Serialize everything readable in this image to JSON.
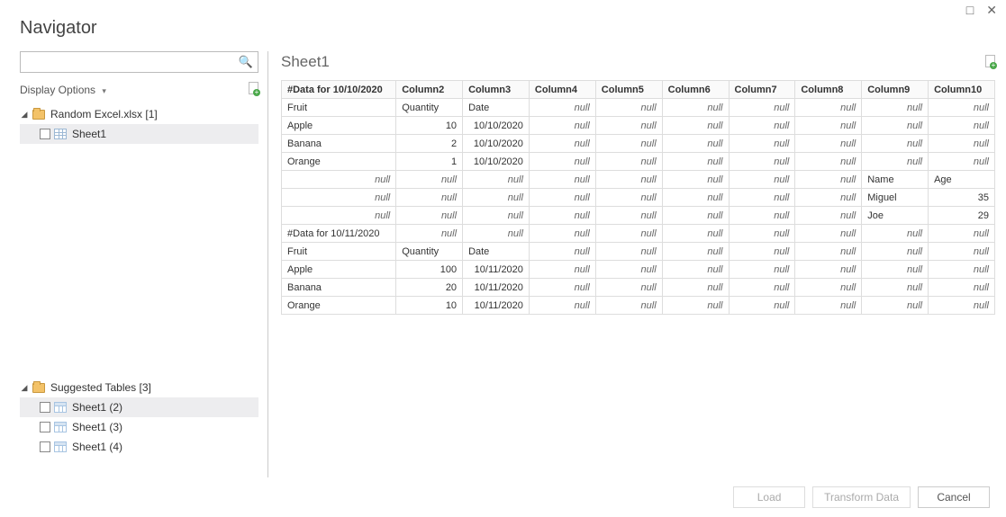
{
  "window": {
    "title": "Navigator",
    "maximize_glyph": "□",
    "close_glyph": "✕"
  },
  "left": {
    "search_placeholder": "",
    "display_options_label": "Display Options",
    "tree": {
      "file_label": "Random Excel.xlsx [1]",
      "file_children": [
        {
          "label": "Sheet1",
          "selected": true
        }
      ],
      "suggested_label": "Suggested Tables [3]",
      "suggested_children": [
        {
          "label": "Sheet1 (2)",
          "selected": true
        },
        {
          "label": "Sheet1 (3)",
          "selected": false
        },
        {
          "label": "Sheet1 (4)",
          "selected": false
        }
      ]
    }
  },
  "preview": {
    "title": "Sheet1",
    "columns": [
      "#Data for 10/10/2020",
      "Column2",
      "Column3",
      "Column4",
      "Column5",
      "Column6",
      "Column7",
      "Column8",
      "Column9",
      "Column10"
    ],
    "right_align_from": 1,
    "rows": [
      [
        "Fruit",
        "Quantity",
        "Date",
        null,
        null,
        null,
        null,
        null,
        null,
        null
      ],
      [
        "Apple",
        "10",
        "10/10/2020",
        null,
        null,
        null,
        null,
        null,
        null,
        null
      ],
      [
        "Banana",
        "2",
        "10/10/2020",
        null,
        null,
        null,
        null,
        null,
        null,
        null
      ],
      [
        "Orange",
        "1",
        "10/10/2020",
        null,
        null,
        null,
        null,
        null,
        null,
        null
      ],
      [
        null,
        null,
        null,
        null,
        null,
        null,
        null,
        null,
        "Name",
        "Age"
      ],
      [
        null,
        null,
        null,
        null,
        null,
        null,
        null,
        null,
        "Miguel",
        "35"
      ],
      [
        null,
        null,
        null,
        null,
        null,
        null,
        null,
        null,
        "Joe",
        "29"
      ],
      [
        "#Data for 10/11/2020",
        null,
        null,
        null,
        null,
        null,
        null,
        null,
        null,
        null
      ],
      [
        "Fruit",
        "Quantity",
        "Date",
        null,
        null,
        null,
        null,
        null,
        null,
        null
      ],
      [
        "Apple",
        "100",
        "10/11/2020",
        null,
        null,
        null,
        null,
        null,
        null,
        null
      ],
      [
        "Banana",
        "20",
        "10/11/2020",
        null,
        null,
        null,
        null,
        null,
        null,
        null
      ],
      [
        "Orange",
        "10",
        "10/11/2020",
        null,
        null,
        null,
        null,
        null,
        null,
        null
      ]
    ],
    "left_text_cells": {
      "0": [
        0,
        1,
        2
      ],
      "4": [
        8,
        9
      ],
      "5": [
        8
      ],
      "6": [
        8
      ],
      "7": [
        0
      ],
      "8": [
        0,
        1,
        2
      ]
    }
  },
  "footer": {
    "load": "Load",
    "transform": "Transform Data",
    "cancel": "Cancel"
  }
}
